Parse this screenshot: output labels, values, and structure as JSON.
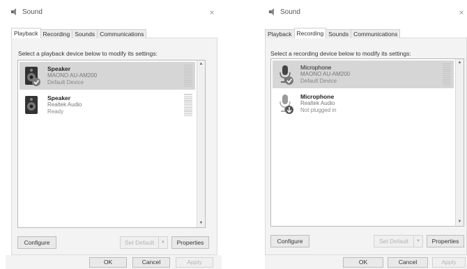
{
  "playback": {
    "title": "Sound",
    "close_glyph": "×",
    "tabs": [
      {
        "label": "Playback",
        "active": true
      },
      {
        "label": "Recording",
        "active": false
      },
      {
        "label": "Sounds",
        "active": false
      },
      {
        "label": "Communications",
        "active": false
      }
    ],
    "instruction": "Select a playback device below to modify its settings:",
    "devices": [
      {
        "name": "Speaker",
        "driver": "MAONO AU-AM200",
        "status": "Default Device",
        "selected": true,
        "icon": "speaker-icon",
        "badge": "default-check-icon"
      },
      {
        "name": "Speaker",
        "driver": "Realtek Audio",
        "status": "Ready",
        "selected": false,
        "icon": "speaker-icon",
        "badge": ""
      }
    ],
    "buttons": {
      "configure": "Configure",
      "set_default": "Set Default",
      "properties": "Properties",
      "ok": "OK",
      "cancel": "Cancel",
      "apply": "Apply"
    }
  },
  "recording": {
    "title": "Sound",
    "close_glyph": "×",
    "tabs": [
      {
        "label": "Playback",
        "active": false
      },
      {
        "label": "Recording",
        "active": true
      },
      {
        "label": "Sounds",
        "active": false
      },
      {
        "label": "Communications",
        "active": false
      }
    ],
    "instruction": "Select a recording device below to modify its settings:",
    "devices": [
      {
        "name": "Microphone",
        "driver": "MAONO AU-AM200",
        "status": "Default Device",
        "selected": true,
        "icon": "microphone-icon",
        "badge": "default-check-icon"
      },
      {
        "name": "Microphone",
        "driver": "Realtek Audio",
        "status": "Not plugged in",
        "selected": false,
        "icon": "microphone-icon",
        "badge": "unplugged-arrow-icon"
      }
    ],
    "buttons": {
      "configure": "Configure",
      "set_default": "Set Default",
      "properties": "Properties",
      "ok": "OK",
      "cancel": "Cancel",
      "apply": "Apply"
    }
  },
  "colors": {
    "selection": "#d6d6d6",
    "check_badge": "#7a7a7a",
    "dialog_face": "#f3f3f3"
  }
}
